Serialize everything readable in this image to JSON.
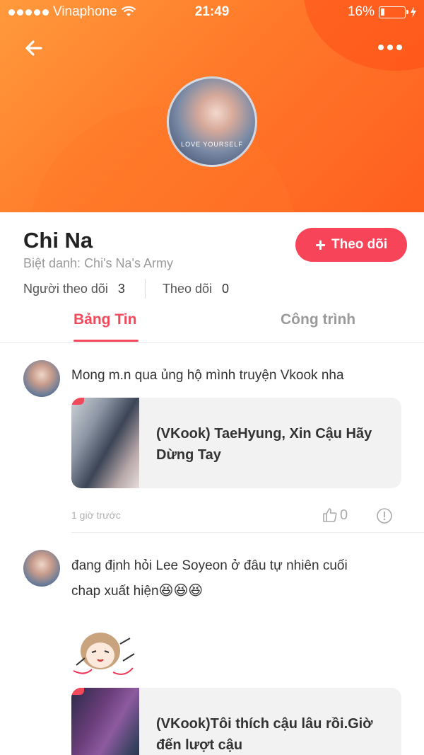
{
  "status_bar": {
    "carrier": "Vinaphone",
    "time": "21:49",
    "battery": "16%"
  },
  "profile": {
    "name": "Chi Na",
    "nickname": "Biệt danh: Chi's Na's Army",
    "followers_label": "Người theo dõi",
    "followers_count": "3",
    "following_label": "Theo dõi",
    "following_count": "0",
    "follow_button": "Theo dõi",
    "avatar_caption": "LOVE YOURSELF"
  },
  "tabs": [
    {
      "label": "Bảng Tin",
      "active": true
    },
    {
      "label": "Công trình",
      "active": false
    }
  ],
  "posts": [
    {
      "text": "Mong m.n qua ủng hộ mình truyện Vkook nha",
      "card_title": "(VKook) TaeHyung, Xin Cậu Hãy Dừng Tay",
      "time": "1 giờ trước",
      "likes": "0"
    },
    {
      "text_line1": "đang định hỏi Lee Soyeon ở đâu tự nhiên cuối",
      "text_line2": "chap xuất hiện",
      "emojis": "😆😆😆",
      "card_title": "(VKook)Tôi thích cậu lâu rồi.Giờ đến lượt cậu"
    }
  ],
  "colors": {
    "accent": "#f24a5b",
    "header_gradient_start": "#ff9a3c",
    "header_gradient_end": "#ff5e1f"
  }
}
